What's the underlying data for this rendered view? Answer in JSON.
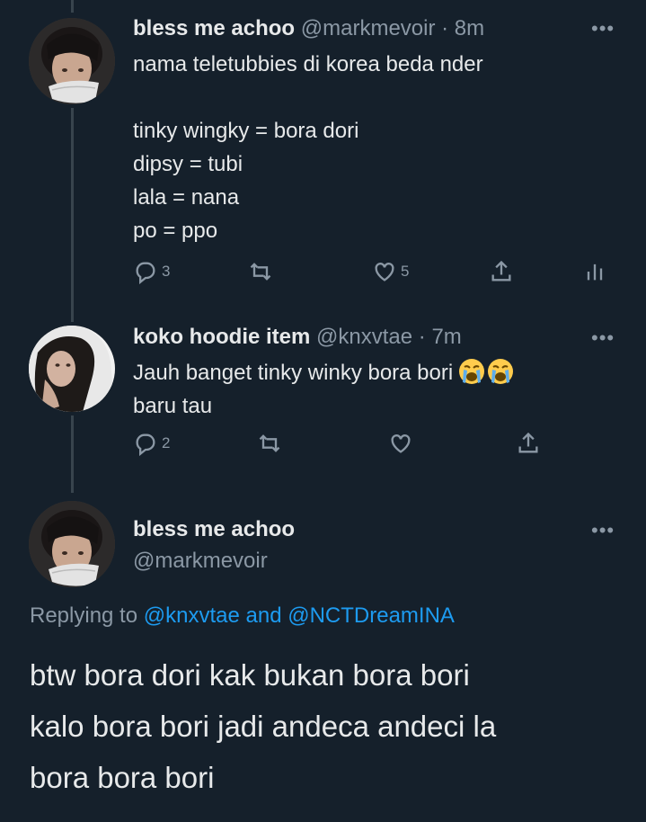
{
  "tweets": [
    {
      "name": "bless me achoo",
      "handle": "@markmevoir",
      "time": "· 8m",
      "text": "nama teletubbies di korea beda nder\n\ntinky wingky = bora dori\ndipsy = tubi\nlala = nana\npo = ppo",
      "replies": "3",
      "likes": "5"
    },
    {
      "name": "koko hoodie item",
      "handle": "@knxvtae",
      "time": "· 7m",
      "text_line1": "Jauh banget tinky winky bora bori",
      "text_line2": "baru tau",
      "replies": "2"
    }
  ],
  "main_tweet": {
    "name": "bless me achoo",
    "handle": "@markmevoir",
    "replying_prefix": "Replying to",
    "mention1": "@knxvtae",
    "and": "and",
    "mention2": "@NCTDreamINA",
    "text": "btw bora dori kak bukan bora bori\nkalo bora bori jadi andeca andeci la\nbora bora bori"
  },
  "icons": [
    "reply-icon",
    "retweet-icon",
    "like-icon",
    "share-icon",
    "analytics-icon",
    "more-icon",
    "crying-emoji"
  ],
  "colors": {
    "background": "#15202b",
    "text": "#e7e9ea",
    "muted": "#8b98a5",
    "link": "#1d9bf0",
    "thread_line": "#38444d"
  }
}
